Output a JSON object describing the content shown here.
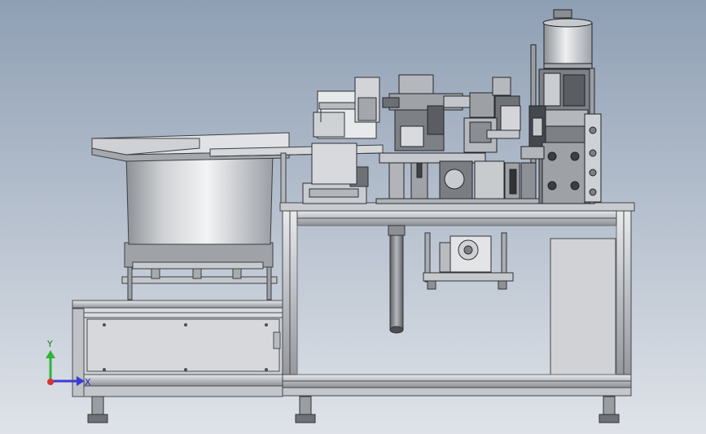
{
  "viewport": {
    "background_top": "#8f9fb4",
    "background_bottom": "#dfe3e9"
  },
  "model": {
    "frame_color": "#c9ccd0",
    "panel_color": "#d2d4d7",
    "steel_color": "#a9adb2",
    "dark_color": "#3a3d42",
    "bowl_top": "#d7d9dc",
    "bowl_mid": "#f1f2f3",
    "bowl_shadow": "#8f9398"
  },
  "triad": {
    "y_label": "Y",
    "x_label": "X",
    "y_color": "#2fb33b",
    "x_color": "#3b3bd6",
    "z_color": "#d63535"
  }
}
